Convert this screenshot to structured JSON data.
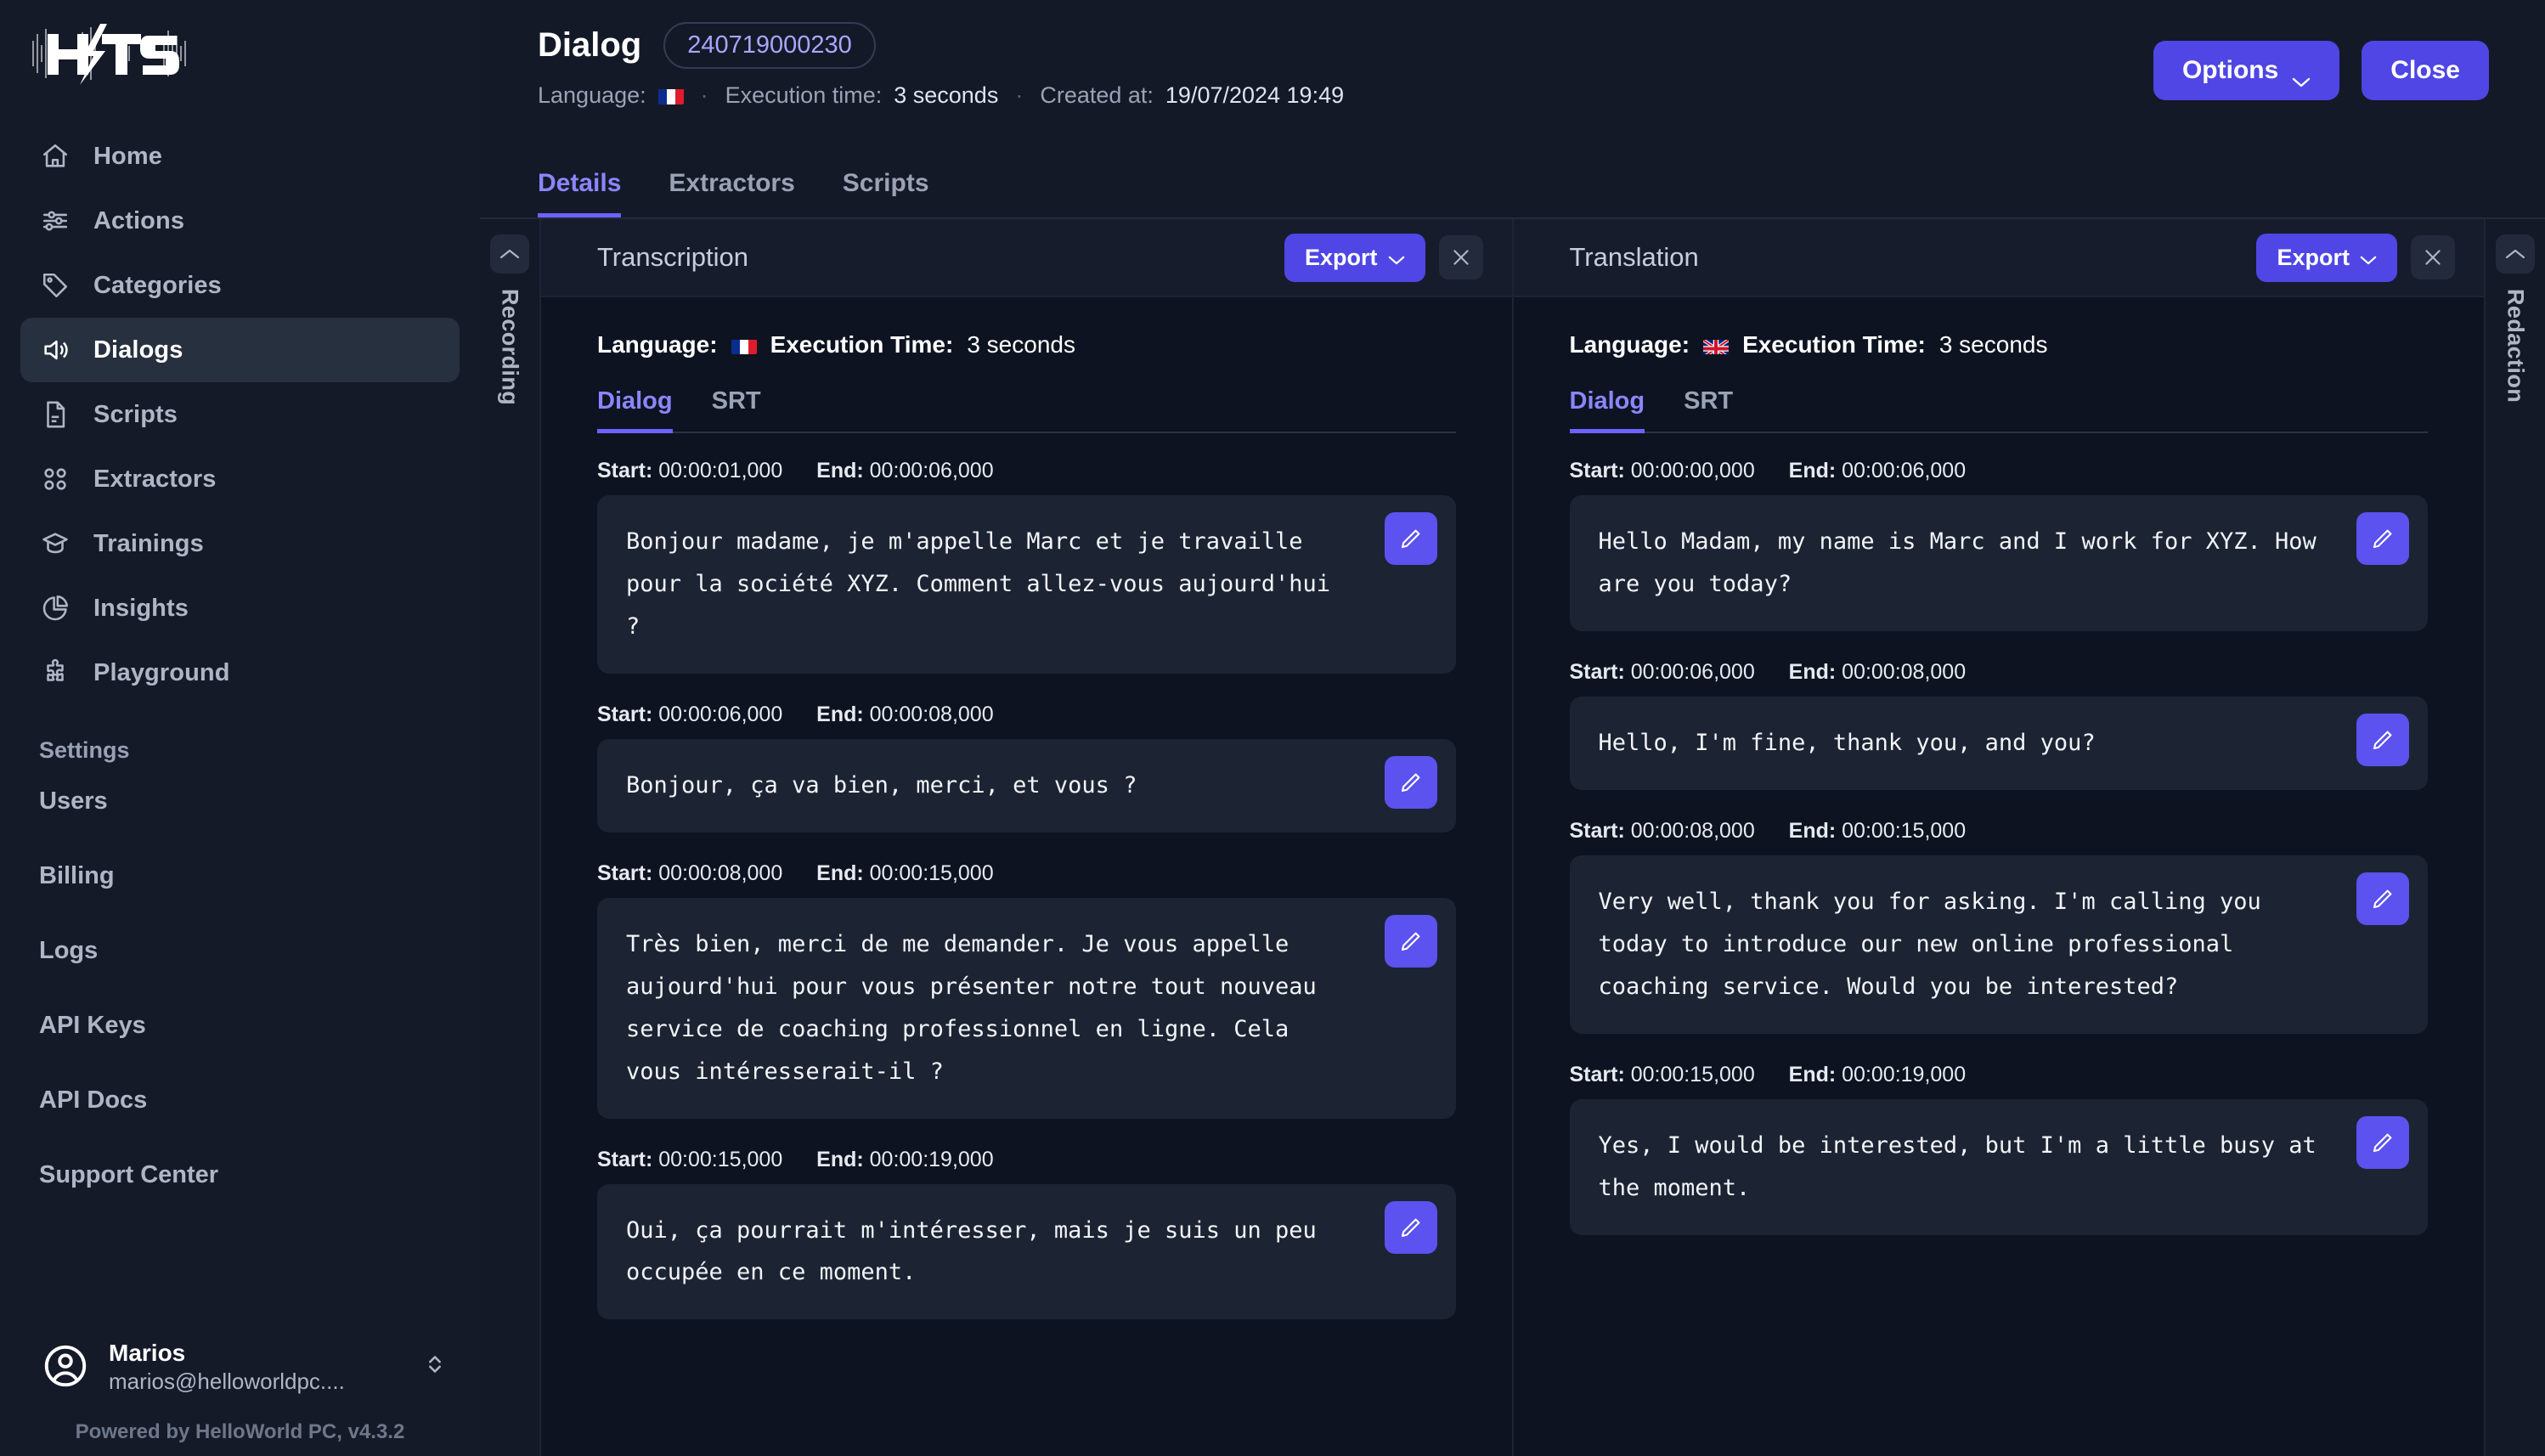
{
  "brand": {
    "logo_text": "HITS",
    "powered_by": "Powered by HelloWorld PC, v4.3.2"
  },
  "sidebar": {
    "items": [
      {
        "label": "Home",
        "icon": "home-icon"
      },
      {
        "label": "Actions",
        "icon": "sliders-icon"
      },
      {
        "label": "Categories",
        "icon": "tag-icon"
      },
      {
        "label": "Dialogs",
        "icon": "speaker-icon"
      },
      {
        "label": "Scripts",
        "icon": "document-icon"
      },
      {
        "label": "Extractors",
        "icon": "grid-icon"
      },
      {
        "label": "Trainings",
        "icon": "graduation-cap-icon"
      },
      {
        "label": "Insights",
        "icon": "pie-chart-icon"
      },
      {
        "label": "Playground",
        "icon": "puzzle-icon"
      }
    ],
    "settings_header": "Settings",
    "settings_items": [
      {
        "label": "Users"
      },
      {
        "label": "Billing"
      },
      {
        "label": "Logs"
      },
      {
        "label": "API Keys"
      },
      {
        "label": "API Docs"
      },
      {
        "label": "Support Center"
      }
    ],
    "user": {
      "name": "Marios",
      "email": "marios@helloworldpc...."
    }
  },
  "header": {
    "title": "Dialog",
    "id_badge": "240719000230",
    "language_label": "Language:",
    "language_flag": "flag-fr-icon",
    "execution_time_label": "Execution time:",
    "execution_time_value": "3 seconds",
    "created_at_label": "Created at:",
    "created_at_value": "19/07/2024 19:49",
    "options_label": "Options",
    "close_label": "Close",
    "tabs": [
      {
        "label": "Details",
        "active": true
      },
      {
        "label": "Extractors",
        "active": false
      },
      {
        "label": "Scripts",
        "active": false
      }
    ]
  },
  "rails": {
    "left": {
      "label": "Recording",
      "icon": "chevron-up-icon"
    },
    "right": {
      "label": "Redaction",
      "icon": "chevron-up-icon"
    }
  },
  "transcription": {
    "title": "Transcription",
    "export_label": "Export",
    "close_icon": "close-icon",
    "language_label": "Language:",
    "language_flag": "flag-fr-icon",
    "execution_label": "Execution Time:",
    "execution_value": "3 seconds",
    "subtabs": [
      {
        "label": "Dialog",
        "active": true
      },
      {
        "label": "SRT",
        "active": false
      }
    ],
    "start_label": "Start:",
    "end_label": "End:",
    "segments": [
      {
        "start": "00:00:01,000",
        "end": "00:00:06,000",
        "text": "Bonjour madame, je m'appelle Marc et je travaille pour la société XYZ. Comment allez-vous aujourd'hui ?"
      },
      {
        "start": "00:00:06,000",
        "end": "00:00:08,000",
        "text": "Bonjour, ça va bien, merci, et vous ?"
      },
      {
        "start": "00:00:08,000",
        "end": "00:00:15,000",
        "text": "Très bien, merci de me demander. Je vous appelle aujourd'hui pour vous présenter notre tout nouveau service de coaching professionnel en ligne. Cela vous intéresserait-il ?"
      },
      {
        "start": "00:00:15,000",
        "end": "00:00:19,000",
        "text": "Oui, ça pourrait m'intéresser, mais je suis un peu occupée en ce moment."
      }
    ]
  },
  "translation": {
    "title": "Translation",
    "export_label": "Export",
    "close_icon": "close-icon",
    "language_label": "Language:",
    "language_flag": "flag-gb-icon",
    "execution_label": "Execution Time:",
    "execution_value": "3 seconds",
    "subtabs": [
      {
        "label": "Dialog",
        "active": true
      },
      {
        "label": "SRT",
        "active": false
      }
    ],
    "start_label": "Start:",
    "end_label": "End:",
    "segments": [
      {
        "start": "00:00:00,000",
        "end": "00:00:06,000",
        "text": "Hello Madam, my name is Marc and I work for XYZ. How are you today?"
      },
      {
        "start": "00:00:06,000",
        "end": "00:00:08,000",
        "text": "Hello, I'm fine, thank you, and you?"
      },
      {
        "start": "00:00:08,000",
        "end": "00:00:15,000",
        "text": "Very well, thank you for asking. I'm calling you today to introduce our new online professional coaching service. Would you be interested?"
      },
      {
        "start": "00:00:15,000",
        "end": "00:00:19,000",
        "text": "Yes, I would be interested, but I'm a little busy at the moment."
      }
    ]
  },
  "colors": {
    "accent": "#4f46e5",
    "accent_text": "#8b86ff",
    "sidebar_bg": "#151a29",
    "panel_bg": "#0d1320",
    "panel_head_bg": "#171c2c",
    "bubble_bg": "#1c2433"
  }
}
